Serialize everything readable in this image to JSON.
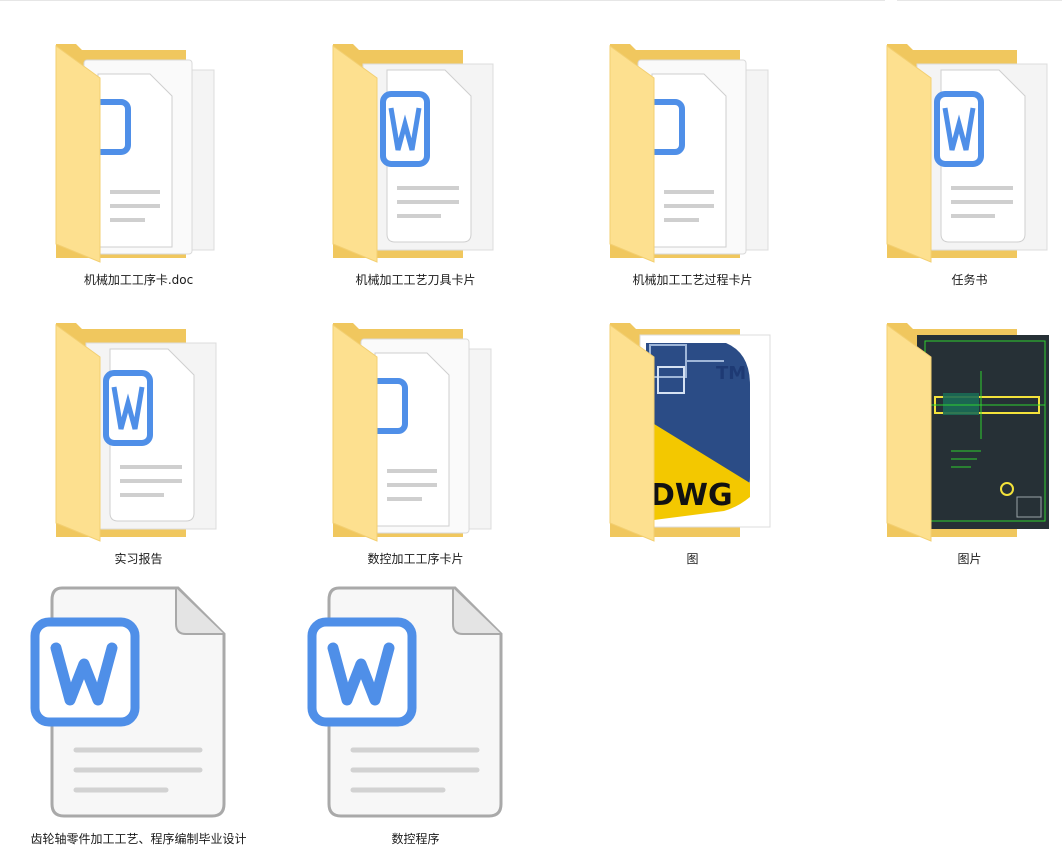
{
  "items": [
    {
      "name": "机械加工工序卡.doc",
      "type": "folder",
      "icon": "folder-word-stack-icon"
    },
    {
      "name": "机械加工工艺刀具卡片",
      "type": "folder",
      "icon": "folder-word-icon"
    },
    {
      "name": "机械加工工艺过程卡片",
      "type": "folder",
      "icon": "folder-word-stack-icon"
    },
    {
      "name": "任务书",
      "type": "folder",
      "icon": "folder-word-icon"
    },
    {
      "name": "实习报告",
      "type": "folder",
      "icon": "folder-word-icon"
    },
    {
      "name": "数控加工工序卡片",
      "type": "folder",
      "icon": "folder-word-stack-icon"
    },
    {
      "name": "图",
      "type": "folder",
      "icon": "folder-dwg-icon",
      "badge": "DWG",
      "tm": "TM"
    },
    {
      "name": "图片",
      "type": "folder",
      "icon": "folder-cad-image-icon"
    },
    {
      "name": "齿轮轴零件加工工艺、程序编制毕业设计",
      "type": "document",
      "icon": "word-document-icon"
    },
    {
      "name": "数控程序",
      "type": "document",
      "icon": "word-document-icon"
    }
  ],
  "colors": {
    "folder_back": "#f0c75e",
    "folder_front": "#fde08f",
    "word_blue": "#4f8fe8",
    "paper": "#f7f7f7",
    "dwg_yellow": "#f3c800",
    "dwg_blue": "#2b4c86",
    "cad_bg": "#263036",
    "cad_green": "#2fd12f"
  }
}
